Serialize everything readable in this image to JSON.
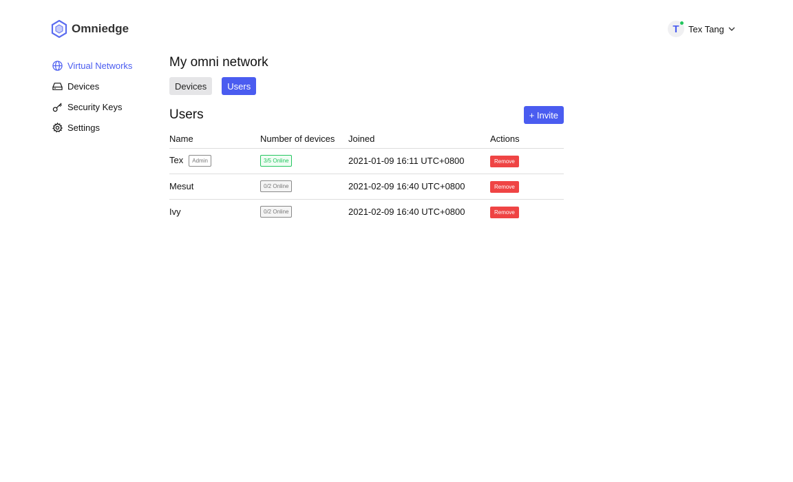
{
  "app": {
    "name": "Omniedge"
  },
  "user": {
    "initial": "T",
    "name": "Tex Tang"
  },
  "sidebar": {
    "items": [
      {
        "label": "Virtual Networks"
      },
      {
        "label": "Devices"
      },
      {
        "label": "Security Keys"
      },
      {
        "label": "Settings"
      }
    ]
  },
  "main": {
    "title": "My omni network",
    "tabs": [
      {
        "label": "Devices"
      },
      {
        "label": "Users"
      }
    ],
    "section_title": "Users",
    "invite_label": "+ Invite",
    "columns": [
      "Name",
      "Number of devices",
      "Joined",
      "Actions"
    ],
    "rows": [
      {
        "name": "Tex",
        "role": "Admin",
        "devices": "3/5 Online",
        "joined": "2021-01-09 16:11 UTC+0800",
        "action": "Remove"
      },
      {
        "name": "Mesut",
        "devices": "0/2 Online",
        "joined": "2021-02-09 16:40 UTC+0800",
        "action": "Remove"
      },
      {
        "name": "Ivy",
        "devices": "0/2 Online",
        "joined": "2021-02-09 16:40 UTC+0800",
        "action": "Remove"
      }
    ]
  },
  "colors": {
    "accent": "#4a5cf0",
    "online": "#22c55e",
    "danger": "#ef4444"
  }
}
